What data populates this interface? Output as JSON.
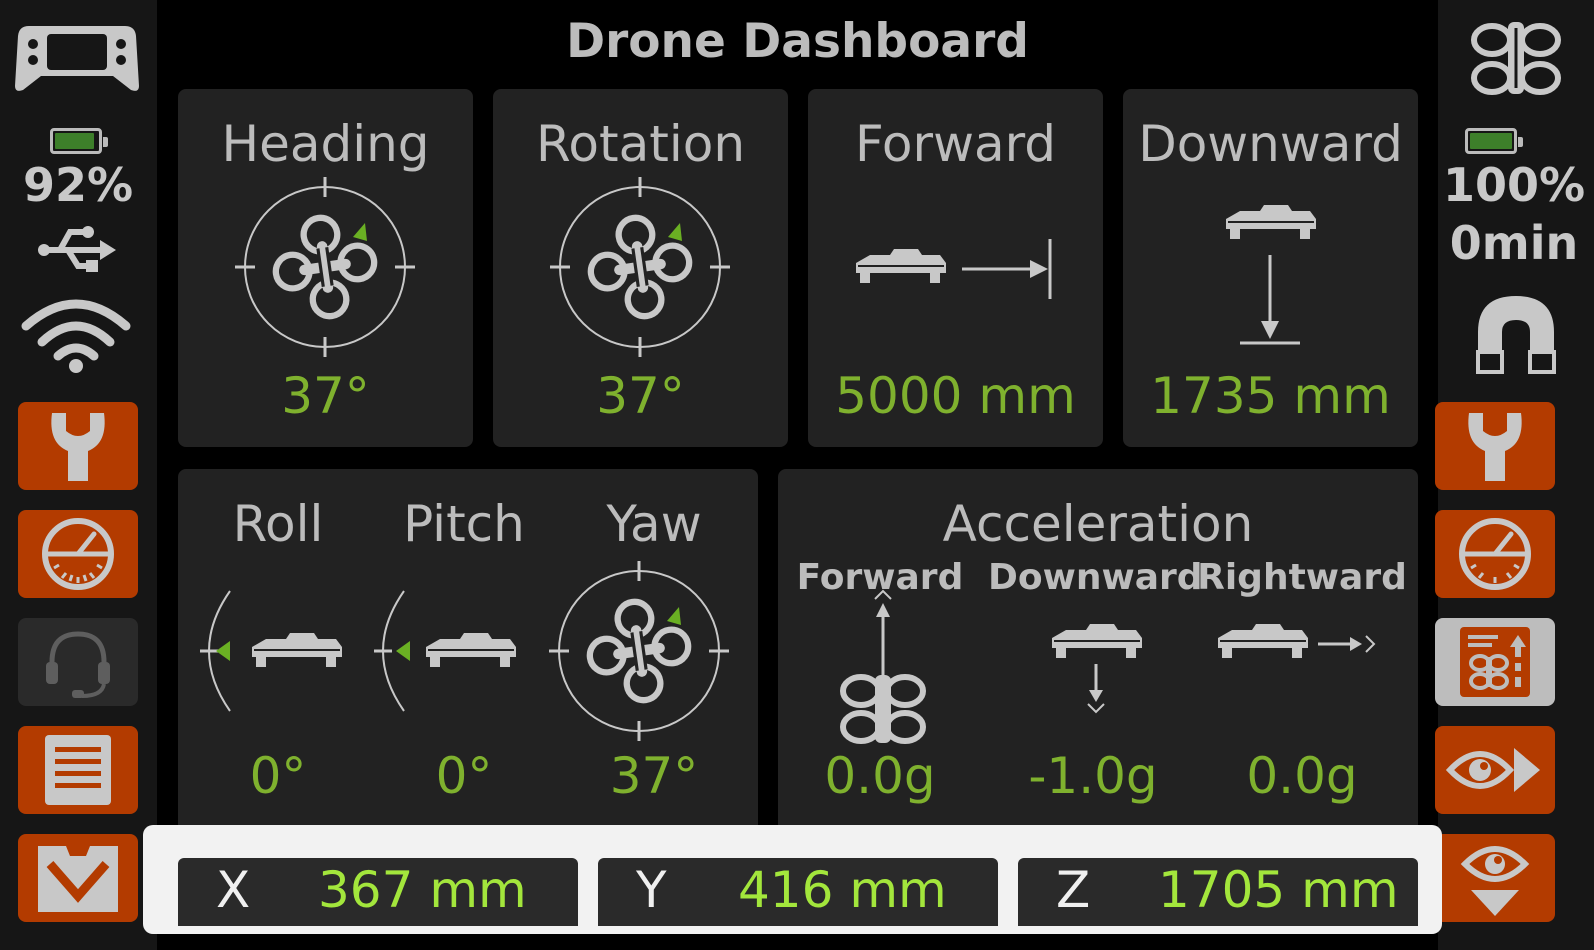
{
  "title": "Drone Dashboard",
  "left_sidebar": {
    "controller_icon": "gamepad-icon",
    "battery_percent": "92%",
    "battery_level": 0.92,
    "buttons": [
      {
        "name": "wrench",
        "icon": "wrench-icon",
        "color": "#b33b00"
      },
      {
        "name": "gauge",
        "icon": "speedometer-icon",
        "color": "#b33b00"
      },
      {
        "name": "headset",
        "icon": "headset-icon",
        "color": "#2a2a2a"
      },
      {
        "name": "document",
        "icon": "document-icon",
        "color": "#b33b00"
      },
      {
        "name": "download",
        "icon": "download-tray-icon",
        "color": "#b33b00"
      }
    ]
  },
  "right_sidebar": {
    "drone_icon": "drone-icon",
    "battery_percent": "100%",
    "battery_level": 1.0,
    "flight_time": "0min",
    "buttons": [
      {
        "name": "wrench",
        "icon": "wrench-icon",
        "color": "#b33b00"
      },
      {
        "name": "gauge",
        "icon": "speedometer-icon",
        "color": "#b33b00"
      },
      {
        "name": "drone-report",
        "icon": "drone-report-icon",
        "color": "#bdbdbd"
      },
      {
        "name": "eye-forward",
        "icon": "eye-forward-icon",
        "color": "#b33b00"
      },
      {
        "name": "eye-down",
        "icon": "eye-down-icon",
        "color": "#b33b00"
      }
    ]
  },
  "panels": {
    "heading": {
      "title": "Heading",
      "value": "37°"
    },
    "rotation": {
      "title": "Rotation",
      "value": "37°"
    },
    "forward": {
      "title": "Forward",
      "value": "5000 mm"
    },
    "downward": {
      "title": "Downward",
      "value": "1735 mm"
    }
  },
  "attitude": {
    "roll": {
      "label": "Roll",
      "value": "0°"
    },
    "pitch": {
      "label": "Pitch",
      "value": "0°"
    },
    "yaw": {
      "label": "Yaw",
      "value": "37°"
    }
  },
  "acceleration": {
    "title": "Acceleration",
    "forward": {
      "label": "Forward",
      "value": "0.0g"
    },
    "downward": {
      "label": "Downward",
      "value": "-1.0g"
    },
    "rightward": {
      "label": "Rightward",
      "value": "0.0g"
    }
  },
  "coordinates": {
    "x": {
      "axis": "X",
      "value": "367 mm"
    },
    "y": {
      "axis": "Y",
      "value": "416 mm"
    },
    "z": {
      "axis": "Z",
      "value": "1705 mm"
    }
  },
  "colors": {
    "accent_button": "#b33b00",
    "value_green": "#7fb12e",
    "coord_green": "#a3e63c",
    "indicator_green": "#6ab023",
    "panel": "#222222"
  }
}
